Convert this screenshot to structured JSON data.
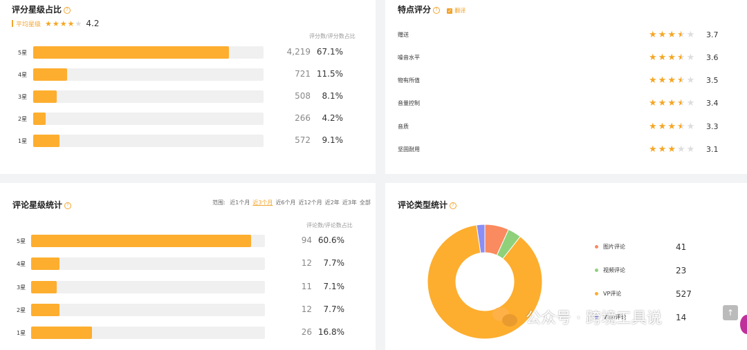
{
  "rating": {
    "title": "评分星级占比",
    "avg_label": "平均星级",
    "avg_value": "4.2",
    "avg_stars": 4.2,
    "column_header": "评分数/评分数占比",
    "rows": [
      {
        "label": "5星",
        "count": "4,219",
        "pct": "67.1%",
        "ratio": 0.851
      },
      {
        "label": "4星",
        "count": "721",
        "pct": "11.5%",
        "ratio": 0.146
      },
      {
        "label": "3星",
        "count": "508",
        "pct": "8.1%",
        "ratio": 0.103
      },
      {
        "label": "2星",
        "count": "266",
        "pct": "4.2%",
        "ratio": 0.053
      },
      {
        "label": "1星",
        "count": "572",
        "pct": "9.1%",
        "ratio": 0.115
      }
    ]
  },
  "features": {
    "title": "特点评分",
    "translate_label": "翻译",
    "rows": [
      {
        "name": "赠送",
        "score": "3.7",
        "stars": 3.7
      },
      {
        "name": "噪音水平",
        "score": "3.6",
        "stars": 3.6
      },
      {
        "name": "物有所值",
        "score": "3.5",
        "stars": 3.5
      },
      {
        "name": "音量控制",
        "score": "3.4",
        "stars": 3.4
      },
      {
        "name": "音质",
        "score": "3.3",
        "stars": 3.3
      },
      {
        "name": "坚固耐用",
        "score": "3.1",
        "stars": 3.1
      }
    ]
  },
  "review": {
    "title": "评论星级统计",
    "range_label": "范围:",
    "ranges": [
      "近1个月",
      "近3个月",
      "近6个月",
      "近12个月",
      "近2年",
      "近3年",
      "全部"
    ],
    "active_range": 1,
    "column_header": "评论数/评论数占比",
    "rows": [
      {
        "label": "5星",
        "count": "94",
        "pct": "60.6%",
        "ratio": 0.94
      },
      {
        "label": "4星",
        "count": "12",
        "pct": "7.7%",
        "ratio": 0.12
      },
      {
        "label": "3星",
        "count": "11",
        "pct": "7.1%",
        "ratio": 0.11
      },
      {
        "label": "2星",
        "count": "12",
        "pct": "7.7%",
        "ratio": 0.12
      },
      {
        "label": "1星",
        "count": "26",
        "pct": "16.8%",
        "ratio": 0.26
      }
    ]
  },
  "review_type": {
    "title": "评论类型统计",
    "items": [
      {
        "name": "图片评论",
        "value": "41",
        "num": 41,
        "color": "#fa8a5f"
      },
      {
        "name": "视频评论",
        "value": "23",
        "num": 23,
        "color": "#8fd17a"
      },
      {
        "name": "VP评论",
        "value": "527",
        "num": 527,
        "color": "#fdae2f"
      },
      {
        "name": "Vine评论",
        "value": "14",
        "num": 14,
        "color": "#8b8ef5"
      }
    ]
  },
  "watermark": {
    "text": "公众号 · 跨境工具说"
  },
  "scroll_top_icon": "arrow-up-icon"
}
